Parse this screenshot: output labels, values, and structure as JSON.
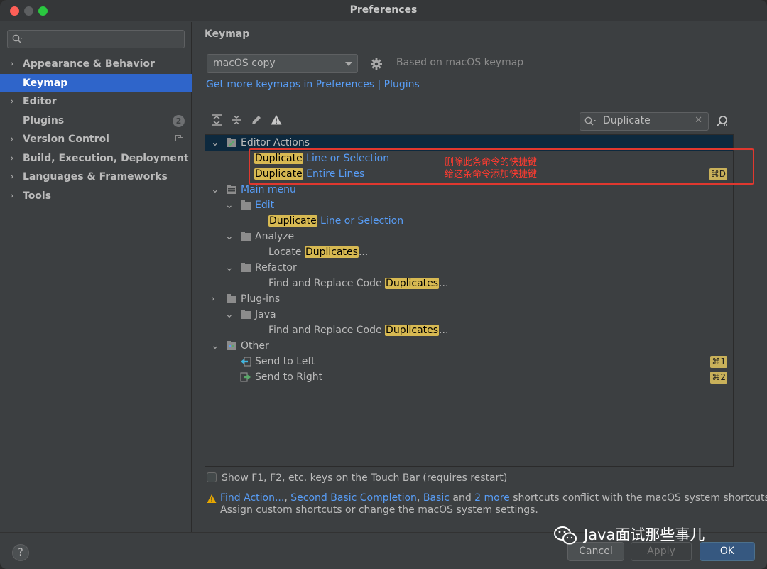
{
  "window": {
    "title": "Preferences"
  },
  "sidebar": {
    "search_placeholder": "",
    "items": [
      {
        "label": "Appearance & Behavior",
        "chevron": "›"
      },
      {
        "label": "Keymap"
      },
      {
        "label": "Editor",
        "chevron": "›"
      },
      {
        "label": "Plugins",
        "badge": "2"
      },
      {
        "label": "Version Control",
        "chevron": "›"
      },
      {
        "label": "Build, Execution, Deployment",
        "chevron": "›"
      },
      {
        "label": "Languages & Frameworks",
        "chevron": "›"
      },
      {
        "label": "Tools",
        "chevron": "›"
      }
    ]
  },
  "keymap": {
    "section_title": "Keymap",
    "selected_keymap": "macOS copy",
    "based_on": "Based on macOS keymap",
    "get_more_link": "Get more keymaps in Preferences | Plugins",
    "filter_value": "Duplicate",
    "filter_clear": "✕"
  },
  "tree": {
    "editor_actions": "Editor Actions",
    "dup": "Duplicate",
    "line_or_selection": "Line or Selection",
    "entire_lines": "Entire Lines",
    "entire_lines_shortcut": "⌘D",
    "main_menu": "Main menu",
    "edit": "Edit",
    "analyze": "Analyze",
    "locate": "Locate",
    "duplicates": "Duplicates",
    "ellipsis": "...",
    "refactor": "Refactor",
    "find_replace": "Find and Replace Code",
    "plugins": "Plug-ins",
    "java": "Java",
    "other": "Other",
    "send_left": "Send to Left",
    "send_left_shortcut": "⌘1",
    "send_right": "Send to Right",
    "send_right_shortcut": "⌘2"
  },
  "annotation": {
    "line1": "删除此条命令的快捷键",
    "line2": "给这条命令添加快捷键"
  },
  "options": {
    "touchbar_label": "Show F1, F2, etc. keys on the Touch Bar (requires restart)"
  },
  "conflict": {
    "link1": "Find Action...",
    "sep1": ", ",
    "link2": "Second Basic Completion",
    "sep2": ", ",
    "link3": "Basic",
    "and": " and ",
    "link4": "2 more",
    "rest": " shortcuts conflict with the macOS system shortcuts.",
    "line2": "Assign custom shortcuts or change the macOS system settings."
  },
  "footer": {
    "help": "?",
    "cancel": "Cancel",
    "apply": "Apply",
    "ok": "OK"
  },
  "watermark": {
    "text": "Java面试那些事儿"
  },
  "colors": {
    "accent": "#2f65ca",
    "link": "#589df6",
    "highlight": "#d7b952",
    "annotation": "#e0382f"
  }
}
